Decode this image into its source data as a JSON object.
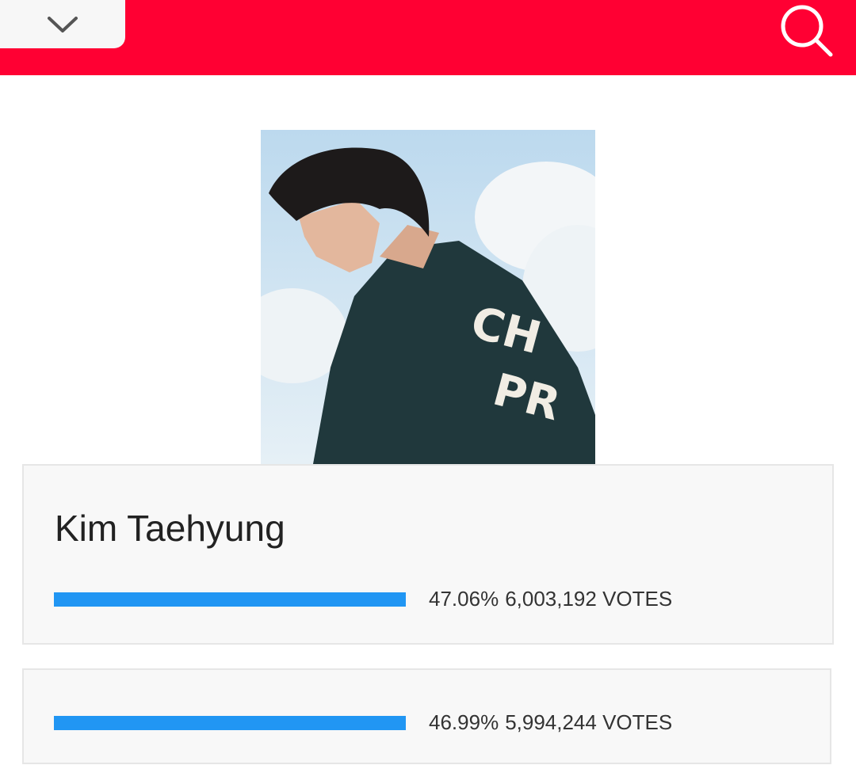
{
  "header": {
    "background_color": "#ff0033",
    "dropdown_icon": "chevron-down-icon",
    "search_icon": "search-icon"
  },
  "candidates": [
    {
      "name": "Kim Taehyung",
      "percent_text": "47.06%",
      "votes_text": "6,003,192 VOTES",
      "progress_percent": 47.06,
      "bar_color": "#2196f3"
    },
    {
      "name": "",
      "percent_text": "46.99%",
      "votes_text": "5,994,244 VOTES",
      "progress_percent": 46.99,
      "bar_color": "#2196f3"
    }
  ]
}
